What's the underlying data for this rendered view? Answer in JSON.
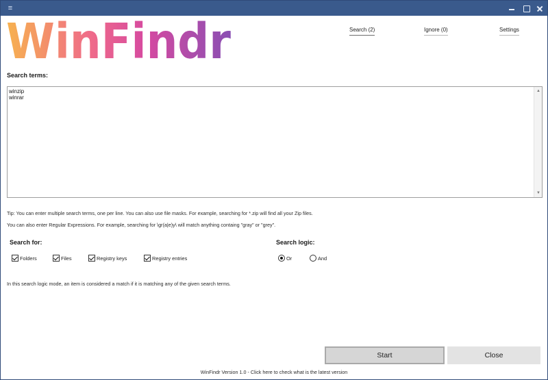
{
  "titlebar": {
    "menu_icon": "hamburger-icon",
    "minimize_icon": "minimize-icon",
    "maximize_icon": "maximize-icon",
    "close_icon": "close-icon"
  },
  "logo": {
    "text": "WinFindr",
    "gradient": [
      "#f7b24f",
      "#ef6a8a",
      "#d64aa0",
      "#8a4fb3"
    ]
  },
  "nav": {
    "search": "Search (2)",
    "ignore": "Ignore (0)",
    "settings": "Settings"
  },
  "search_terms": {
    "label": "Search terms:",
    "value": "winzip\nwinrar"
  },
  "tips": {
    "line1": "Tip: You can enter multiple search terms, one per line. You can also use file masks. For example, searching for *.zip will find all your Zip files.",
    "line2": "You can also enter Regular Expressions. For example, searching for \\gr(a|e)y\\ will match anything containg \"gray\" or \"grey\"."
  },
  "search_for": {
    "label": "Search for:",
    "folders": "Folders",
    "files": "Files",
    "registry_keys": "Registry keys",
    "registry_entries": "Registry entries"
  },
  "search_logic": {
    "label": "Search logic:",
    "or": "Or",
    "and": "And",
    "selected": "Or"
  },
  "logic_description": "In this search logic mode, an item is considered a match if it is matching any of the given search terms.",
  "buttons": {
    "start": "Start",
    "close": "Close"
  },
  "footer": "WinFindr Version 1.0 - Click here to check what is the latest version"
}
